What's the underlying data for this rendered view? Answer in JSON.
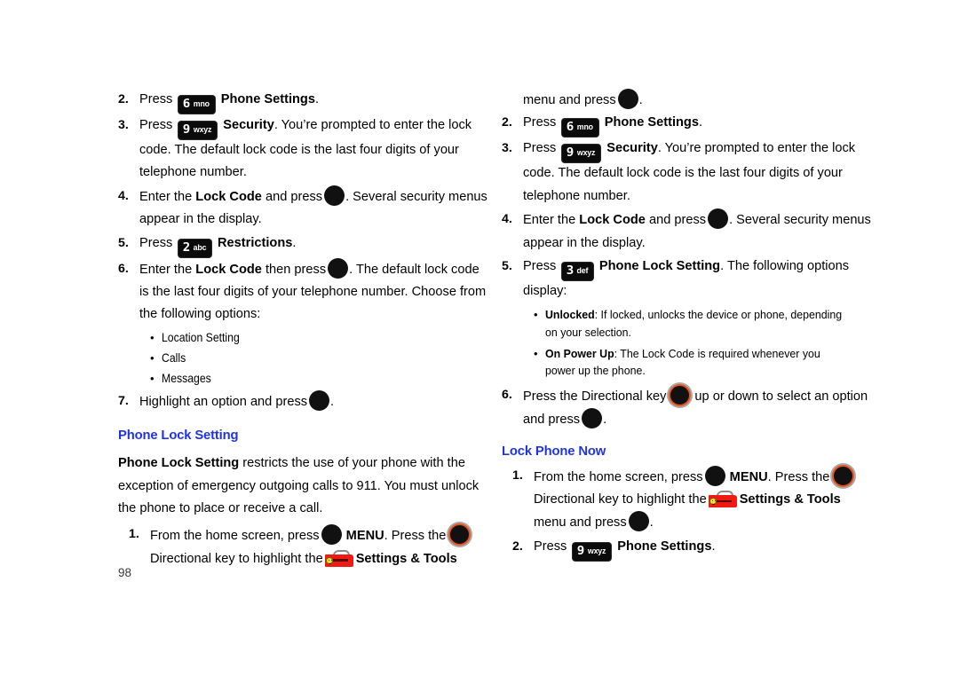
{
  "page": {
    "number": "98",
    "heading_color": "#1f34e0",
    "key_bg_color": "#0b0b0b",
    "directional_ring_color": "#e8541c",
    "toolbox_color": "#ee1b15"
  },
  "left_column": {
    "steps": [
      {
        "num": "2.",
        "pre": "Press",
        "key": {
          "digit": "6",
          "letters": "mno",
          "name": "key-6-mno"
        },
        "bold": "Phone Settings",
        "post": "."
      },
      {
        "num": "3.",
        "pre": "Press",
        "key": {
          "digit": "9",
          "letters": "wxyz",
          "name": "key-9-wxyz"
        },
        "bold": "Security",
        "post": ". You’re prompted to enter the lock code. The default lock code is the last four digits of your telephone number."
      },
      {
        "num": "4.",
        "pre": "Enter the",
        "bold": "Lock Code",
        "mid": "and press",
        "icon": "ok-key",
        "post": ". Several security menus appear in the display."
      },
      {
        "num": "5.",
        "pre": "Press",
        "key": {
          "digit": "2",
          "letters": "abc",
          "name": "key-2-abc"
        },
        "bold": "Restrictions",
        "post": "."
      },
      {
        "num": "6.",
        "pre": "Enter the",
        "bold": "Lock Code",
        "mid": "then press",
        "icon": "ok-key",
        "post": ". The default lock code is the last four digits of your telephone number. Choose from the following options:"
      }
    ],
    "option_bullets": [
      "Location Setting",
      "Calls",
      "Messages"
    ],
    "step7": {
      "num": "7.",
      "pre": "Highlight an option and press",
      "icon": "ok-key",
      "post": "."
    },
    "section": {
      "heading": "Phone Lock Setting",
      "intro_bold": "Phone Lock Setting",
      "intro_rest": "restricts the use of your phone with the exception of emergency outgoing calls to 911. You must unlock the phone to place or receive a call.",
      "step1": {
        "num": "1.",
        "t1": "From the home screen, press",
        "t2": "MENU",
        "t3": ". Press the",
        "t4": "Directional key to highlight the",
        "t5": "Settings & Tools"
      }
    }
  },
  "right_column": {
    "continuation": {
      "text_before": "menu and press",
      "text_after": "."
    },
    "steps": [
      {
        "num": "2.",
        "pre": "Press",
        "key": {
          "digit": "6",
          "letters": "mno",
          "name": "key-6-mno"
        },
        "bold": "Phone Settings",
        "post": "."
      },
      {
        "num": "3.",
        "pre": "Press",
        "key": {
          "digit": "9",
          "letters": "wxyz",
          "name": "key-9-wxyz"
        },
        "bold": "Security",
        "post": ". You’re prompted to enter the lock code. The default lock code is the last four digits of your telephone number."
      },
      {
        "num": "4.",
        "pre": "Enter the",
        "bold": "Lock Code",
        "mid": "and press",
        "icon": "ok-key",
        "post": ". Several security menus appear in the display."
      },
      {
        "num": "5.",
        "pre": "Press",
        "key": {
          "digit": "3",
          "letters": "def",
          "name": "key-3-def"
        },
        "bold": "Phone Lock Setting",
        "post": ". The following options display:"
      }
    ],
    "def_bullets": [
      {
        "term": "Unlocked",
        "definition": ": If locked, unlocks the device or phone, depending on your selection."
      },
      {
        "term": "On Power Up",
        "definition": ": The Lock Code is required whenever you power up the phone."
      }
    ],
    "step6": {
      "num": "6.",
      "pre": "Press the Directional key",
      "mid": "up or down to select an option and press",
      "post": "."
    },
    "section": {
      "heading": "Lock Phone Now",
      "step1": {
        "num": "1.",
        "t1": "From the home screen, press",
        "t2": "MENU",
        "t3": ". Press the",
        "t4": "Directional key to highlight the",
        "t5": "Settings & Tools",
        "t6": "menu and press",
        "t7": "."
      },
      "step2": {
        "num": "2.",
        "pre": "Press",
        "key": {
          "digit": "9",
          "letters": "wxyz",
          "name": "key-9-wxyz"
        },
        "bold": "Phone Settings",
        "post": "."
      }
    }
  }
}
